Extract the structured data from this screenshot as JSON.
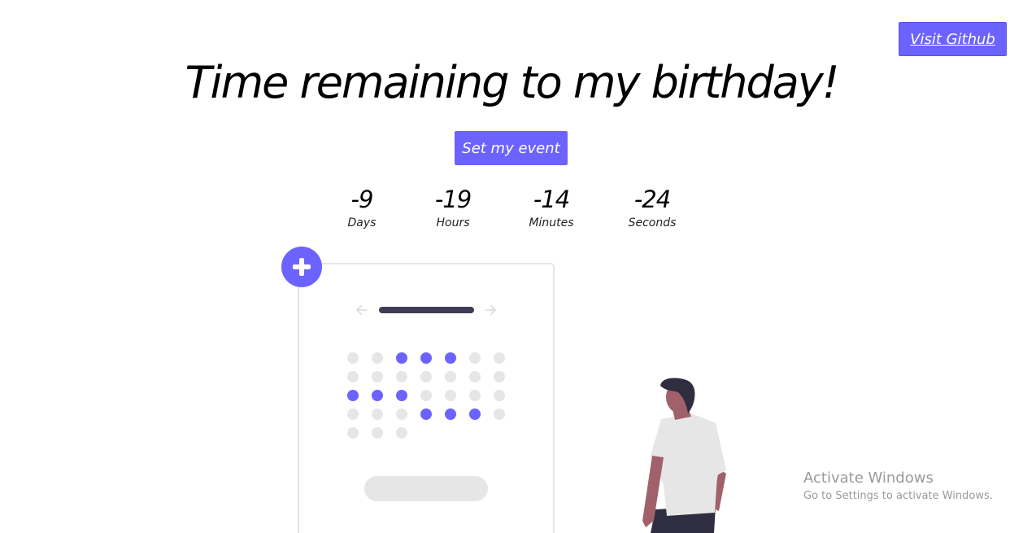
{
  "header": {
    "github_label": "Visit Github",
    "title": "Time remaining to my birthday!",
    "event_button_label": "Set my event"
  },
  "countdown": [
    {
      "value": "-9",
      "unit": "Days"
    },
    {
      "value": "-19",
      "unit": "Hours"
    },
    {
      "value": "-14",
      "unit": "Minutes"
    },
    {
      "value": "-24",
      "unit": "Seconds"
    }
  ],
  "watermark": {
    "line1": "Activate Windows",
    "line2": "Go to Settings to activate Windows."
  },
  "colors": {
    "accent": "#6c63ff",
    "dot_inactive": "#e6e6e6",
    "dark": "#3f3d56"
  },
  "illustration": {
    "add_icon": "plus-icon",
    "prev_icon": "arrow-left-icon",
    "next_icon": "arrow-right-icon",
    "calendar_rows": [
      [
        0,
        0,
        1,
        1,
        1,
        0,
        0
      ],
      [
        0,
        0,
        0,
        0,
        0,
        0,
        0
      ],
      [
        1,
        1,
        1,
        0,
        0,
        0,
        0
      ],
      [
        0,
        0,
        0,
        1,
        1,
        1,
        0
      ],
      [
        0,
        0,
        0
      ]
    ]
  }
}
